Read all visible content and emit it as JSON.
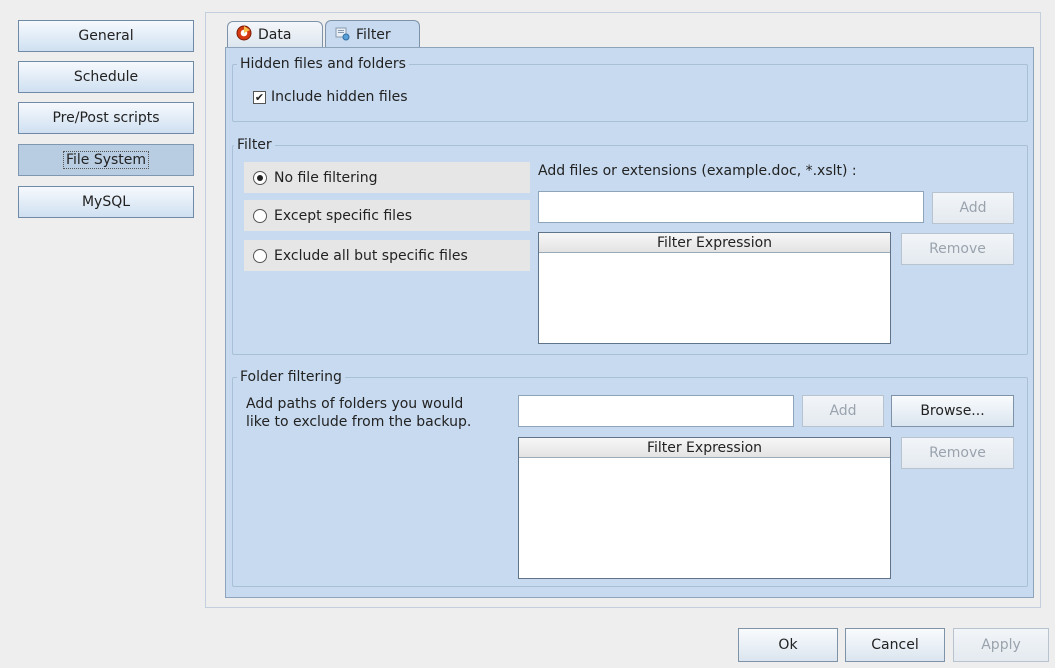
{
  "nav": {
    "items": [
      {
        "label": "General"
      },
      {
        "label": "Schedule"
      },
      {
        "label": "Pre/Post scripts"
      },
      {
        "label": "File System"
      },
      {
        "label": "MySQL"
      }
    ]
  },
  "tabs": [
    {
      "label": "Data",
      "icon": "data-icon"
    },
    {
      "label": "Filter",
      "icon": "filter-icon"
    }
  ],
  "hidden_files": {
    "title": "Hidden files and folders",
    "checkbox_label": "Include hidden files",
    "checked": true
  },
  "filter": {
    "title": "Filter",
    "options": [
      {
        "label": "No file filtering",
        "selected": true
      },
      {
        "label": "Except specific files",
        "selected": false
      },
      {
        "label": "Exclude all but specific files",
        "selected": false
      }
    ],
    "add_label": "Add files or extensions (example.doc, *.xslt) :",
    "input_value": "",
    "add_button": "Add",
    "remove_button": "Remove",
    "list_header": "Filter Expression",
    "items": []
  },
  "folder_filtering": {
    "title": "Folder filtering",
    "description_line1": "Add paths of folders you would",
    "description_line2": "like to exclude from the backup.",
    "input_value": "",
    "add_button": "Add",
    "browse_button": "Browse...",
    "remove_button": "Remove",
    "list_header": "Filter Expression",
    "items": []
  },
  "footer": {
    "ok": "Ok",
    "cancel": "Cancel",
    "apply": "Apply"
  }
}
